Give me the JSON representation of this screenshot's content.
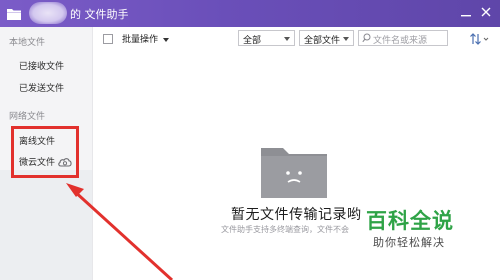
{
  "window": {
    "title": "的 文件助手",
    "accent": "#6a4fb9"
  },
  "sidebar": {
    "local_section": "本地文件",
    "local_items": [
      "已接收文件",
      "已发送文件"
    ],
    "network_section": "网络文件",
    "network_items": [
      "离线文件",
      "微云文件"
    ]
  },
  "toolbar": {
    "batch_label": "批量操作",
    "filter1": "全部",
    "filter2": "全部文件",
    "search_placeholder": "文件名或来源"
  },
  "main": {
    "empty_title": "暂无文件传输记录哟",
    "empty_subtitle": "文件助手支持多终端查询，文件不会"
  },
  "watermark": {
    "title": "百科全说",
    "subtitle": "助你轻松解决",
    "color": "#2fa347"
  },
  "annotation": {
    "color": "#e2312d"
  },
  "icons": [
    "folder-icon",
    "minimize-icon",
    "close-icon",
    "cloud-sync-icon",
    "search-icon",
    "sort-icon",
    "empty-folder-icon"
  ]
}
